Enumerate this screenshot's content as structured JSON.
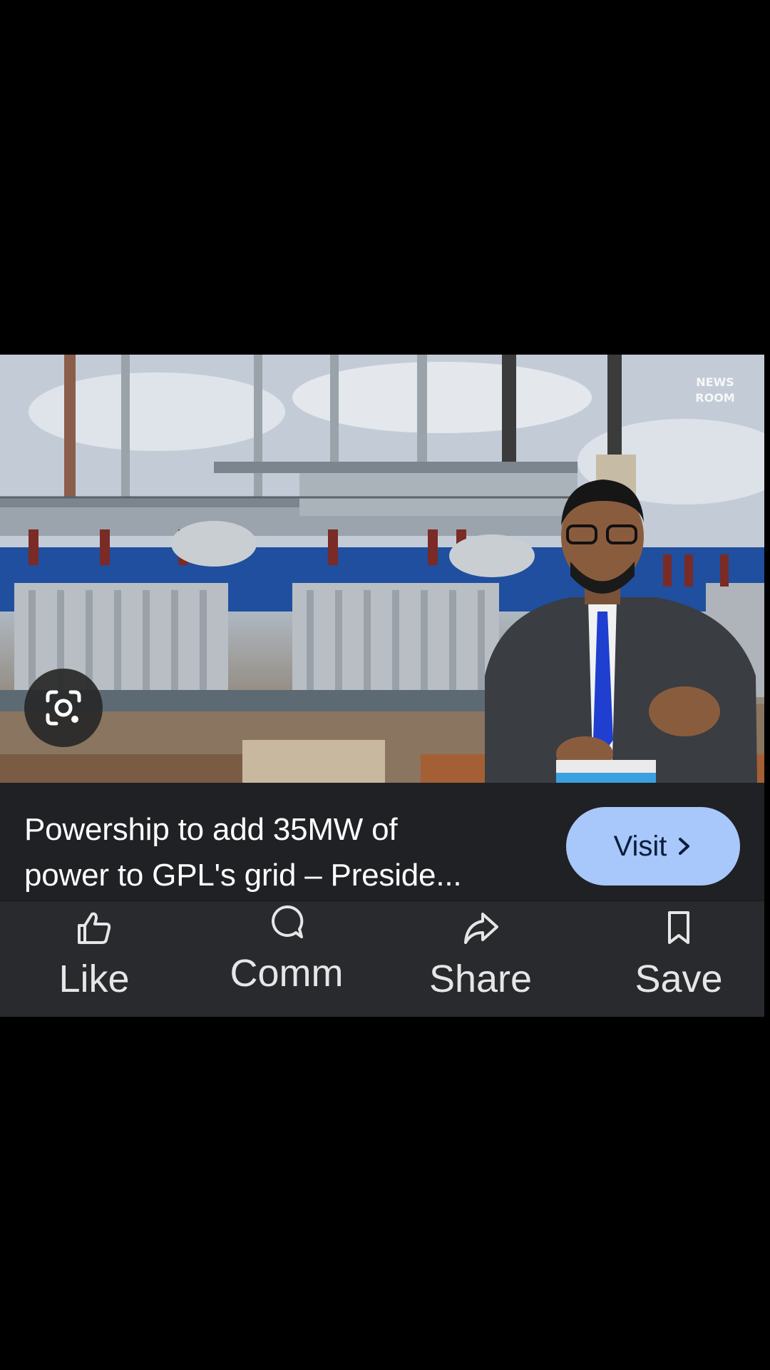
{
  "post": {
    "caption_line1": "Powership to add 35MW of",
    "caption_line2": "power to GPL's grid – Preside...",
    "visit_label": "Visit",
    "visit_chevron": "›"
  },
  "watermark": {
    "text_line1": "NEWS",
    "text_line2": "ROOM"
  },
  "actions": {
    "like": "Like",
    "comment": "Comm",
    "share": "Share",
    "save": "Save"
  },
  "colors": {
    "card_background": "#202124",
    "action_bar_background": "#292a2d",
    "visit_button": "#a8c7fa",
    "screen_background": "#000000"
  },
  "icons": {
    "lens": "google-lens-icon",
    "like": "thumbs-up-icon",
    "comment": "comment-bubble-icon",
    "share": "share-arrow-icon",
    "save": "bookmark-icon"
  }
}
